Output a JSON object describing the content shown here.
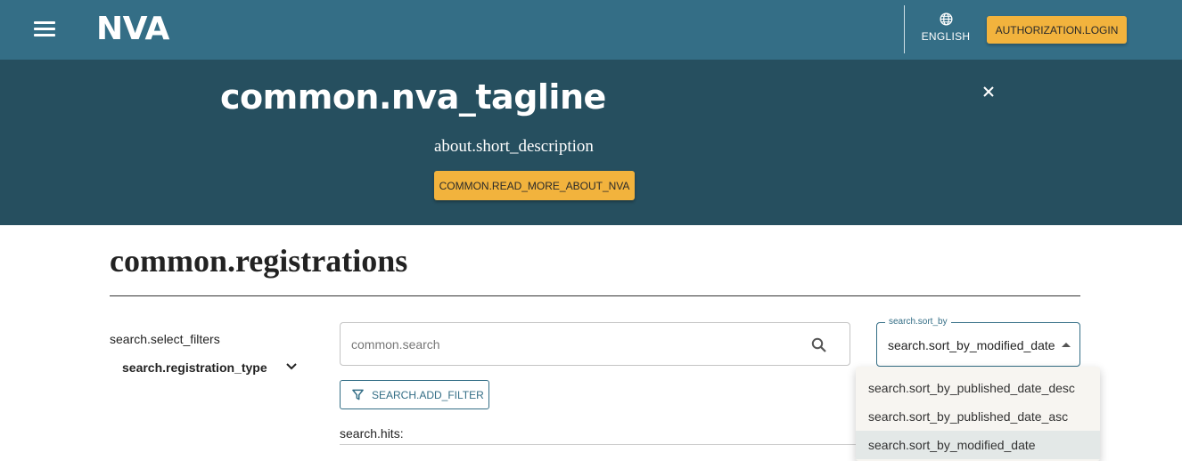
{
  "header": {
    "logo": "NVA",
    "language_label": "ENGLISH",
    "login_label": "AUTHORIZATION.LOGIN"
  },
  "hero": {
    "tagline": "common.nva_tagline",
    "short_description": "about.short_description",
    "read_more_label": "COMMON.READ_MORE_ABOUT_NVA"
  },
  "main": {
    "title": "common.registrations",
    "filters_label": "search.select_filters",
    "registration_type_label": "search.registration_type",
    "search_placeholder": "common.search",
    "sort_by_label": "search.sort_by",
    "sort_by_value": "search.sort_by_modified_date",
    "add_filter_label": "SEARCH.ADD_FILTER",
    "hits_label": "search.hits:"
  },
  "sort_menu": {
    "options": [
      "search.sort_by_published_date_desc",
      "search.sort_by_published_date_asc",
      "search.sort_by_modified_date"
    ],
    "selected_index": 2
  },
  "colors": {
    "header_bg": "#346e86",
    "hero_bg": "#264f5f",
    "accent_button": "#f2b33d"
  },
  "icons": {
    "menu": "hamburger-menu-icon",
    "language": "globe-icon",
    "close": "close-icon",
    "expand": "chevron-down-icon",
    "search": "search-icon",
    "filter": "filter-icon",
    "sort_caret": "caret-up-icon"
  }
}
